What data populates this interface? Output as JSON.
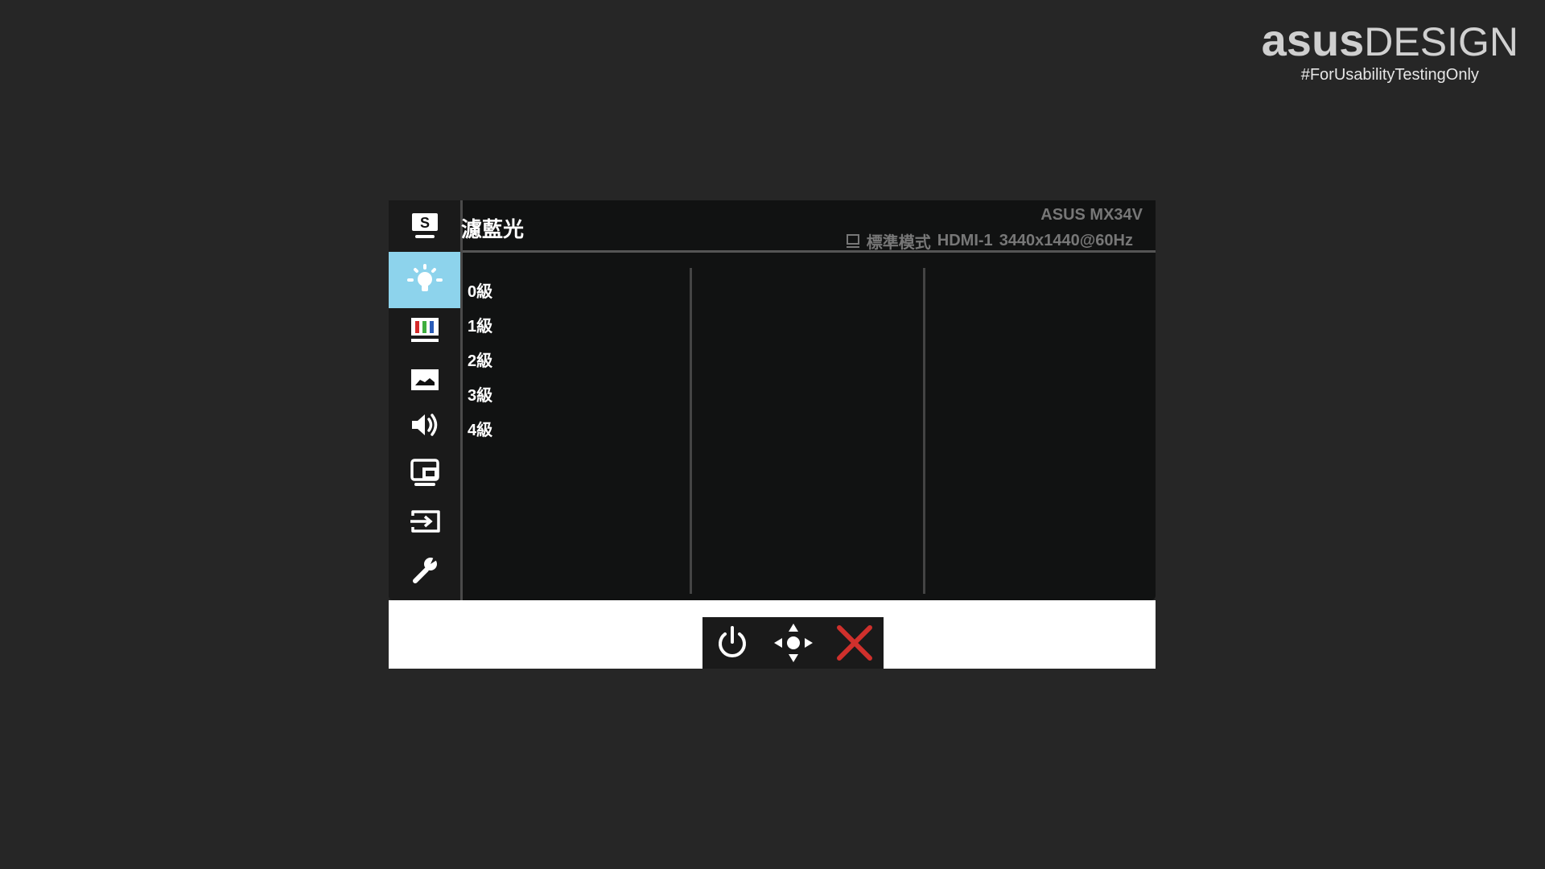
{
  "branding": {
    "logo_bold": "asus",
    "logo_light": "DESIGN",
    "tagline": "#ForUsabilityTestingOnly"
  },
  "osd": {
    "title": "濾藍光",
    "model": "ASUS  MX34V",
    "status": {
      "mode": "標準模式",
      "input": "HDMI-1",
      "resolution": "3440x1440@60Hz"
    },
    "sidebar": [
      {
        "icon": "splendid-icon",
        "selected": false
      },
      {
        "icon": "blue-light-filter-icon",
        "selected": true
      },
      {
        "icon": "color-icon",
        "selected": false
      },
      {
        "icon": "image-icon",
        "selected": false
      },
      {
        "icon": "sound-icon",
        "selected": false
      },
      {
        "icon": "pip-icon",
        "selected": false
      },
      {
        "icon": "input-select-icon",
        "selected": false
      },
      {
        "icon": "system-setup-icon",
        "selected": false
      }
    ],
    "options": [
      "0級",
      "1級",
      "2級",
      "3級",
      "4級"
    ],
    "accent": "#8dd3ec"
  },
  "controls": {
    "icons": [
      "power-icon",
      "joystick-icon",
      "close-icon"
    ],
    "close_color": "#d0302c"
  }
}
